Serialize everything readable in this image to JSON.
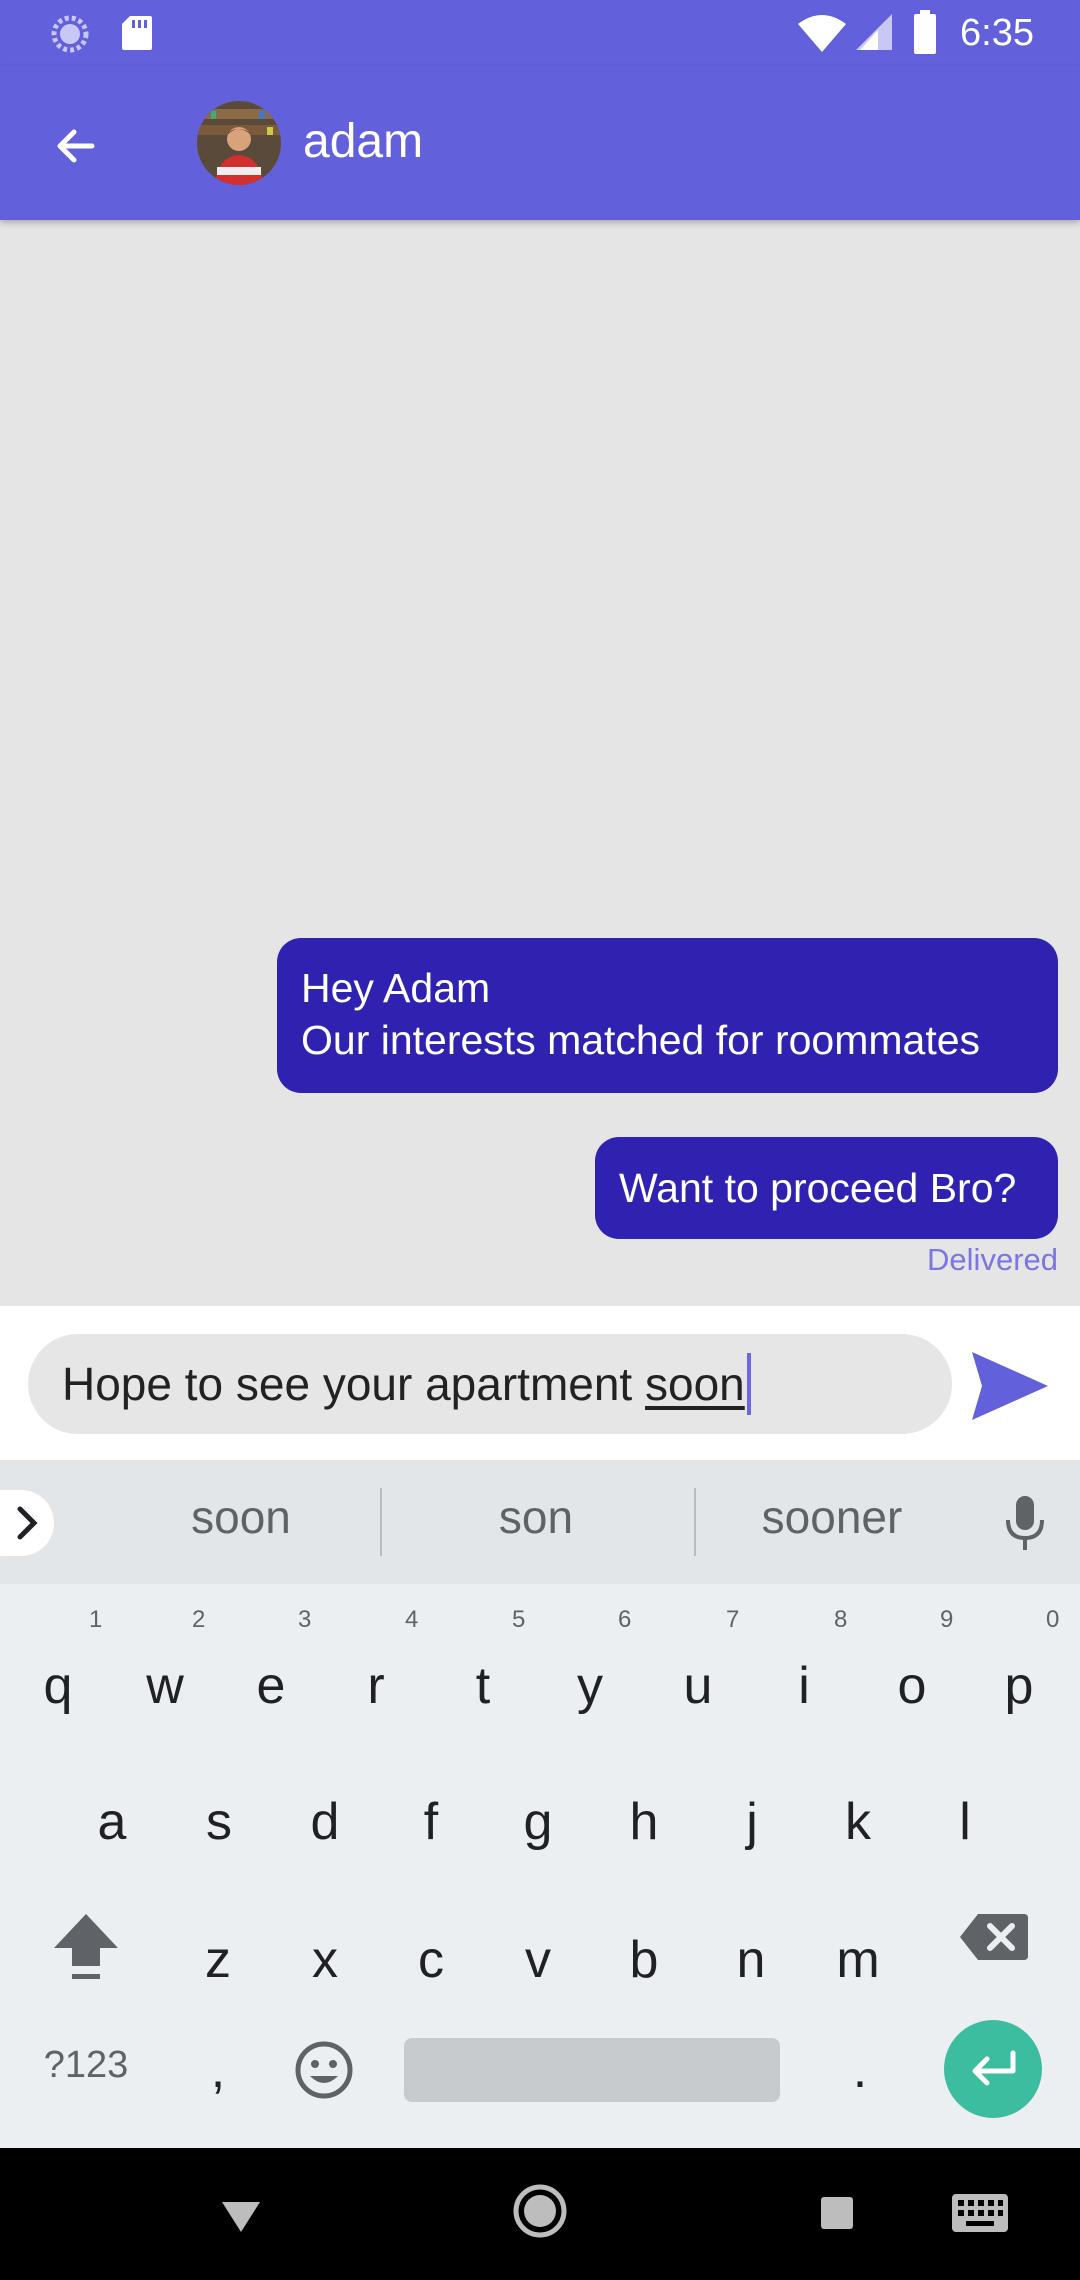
{
  "status_bar": {
    "time": "6:35",
    "left_icons": [
      "loading-icon",
      "sd-card-icon"
    ],
    "right_icons": [
      "wifi-icon",
      "signal-icon",
      "battery-icon"
    ]
  },
  "app_bar": {
    "back_icon": "arrow-left-icon",
    "contact_name": "adam",
    "background_color": "#6360dc"
  },
  "messages": [
    {
      "lines": [
        "Hey Adam",
        "Our interests matched for roommates"
      ],
      "direction": "outgoing"
    },
    {
      "lines": [
        "Want to proceed Bro?"
      ],
      "direction": "outgoing",
      "status": "Delivered"
    }
  ],
  "composer": {
    "text_prefix": "Hope to see your apartment ",
    "text_composing": "soon",
    "send_icon": "send-icon"
  },
  "keyboard": {
    "suggestions": [
      "soon",
      "son",
      "sooner"
    ],
    "row1": [
      "q",
      "w",
      "e",
      "r",
      "t",
      "y",
      "u",
      "i",
      "o",
      "p"
    ],
    "row1_hints": [
      "1",
      "2",
      "3",
      "4",
      "5",
      "6",
      "7",
      "8",
      "9",
      "0"
    ],
    "row2": [
      "a",
      "s",
      "d",
      "f",
      "g",
      "h",
      "j",
      "k",
      "l"
    ],
    "row3": [
      "z",
      "x",
      "c",
      "v",
      "b",
      "n",
      "m"
    ],
    "symbols_label": "?123",
    "comma": ",",
    "period": "."
  },
  "colors": {
    "accent": "#6360dc",
    "bubble": "#3022b0",
    "delivered": "#7b76e0",
    "enter": "#3dbd9f"
  }
}
